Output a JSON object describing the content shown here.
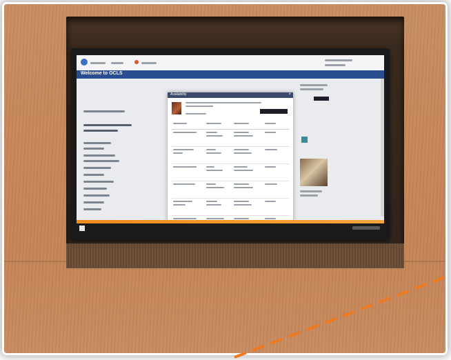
{
  "photo": {
    "subject": "kiosk-monitor-in-wood-wall",
    "colors": {
      "wood": "#c7875a",
      "recess": "#2e241c",
      "site_header": "#2a4d8f",
      "taskbar": "#1b1b1b",
      "accent_orange": "#f08a1c",
      "dashed_line": "#ec7a22"
    }
  },
  "screen": {
    "site_title": "Welcome to OCLS",
    "modal": {
      "title": "Availability"
    },
    "table_rows": 6
  }
}
